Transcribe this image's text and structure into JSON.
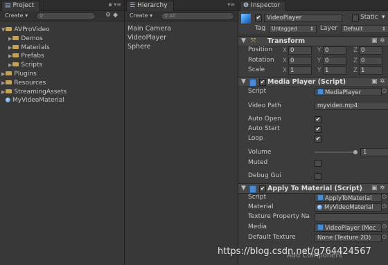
{
  "project": {
    "tab_label": "Project",
    "create_label": "Create",
    "tree": [
      {
        "label": "AVProVideo",
        "depth": 0,
        "expanded": true
      },
      {
        "label": "Demos",
        "depth": 1,
        "expanded": false
      },
      {
        "label": "Materials",
        "depth": 1,
        "expanded": false
      },
      {
        "label": "Prefabs",
        "depth": 1,
        "expanded": false
      },
      {
        "label": "Scripts",
        "depth": 1,
        "expanded": false
      },
      {
        "label": "Plugins",
        "depth": 0,
        "expanded": false
      },
      {
        "label": "Resources",
        "depth": 0,
        "expanded": false
      },
      {
        "label": "StreamingAssets",
        "depth": 0,
        "expanded": false
      },
      {
        "label": "MyVideoMaterial",
        "depth": 0,
        "type": "material"
      }
    ]
  },
  "hierarchy": {
    "tab_label": "Hierarchy",
    "create_label": "Create",
    "search_placeholder": "All",
    "items": [
      "Main Camera",
      "VideoPlayer",
      "Sphere"
    ]
  },
  "inspector": {
    "tab_label": "Inspector",
    "object_name": "VideoPlayer",
    "static_label": "Static",
    "tag_label": "Tag",
    "tag_value": "Untagged",
    "layer_label": "Layer",
    "layer_value": "Default",
    "transform": {
      "title": "Transform",
      "rows": [
        {
          "label": "Position",
          "x": "0",
          "y": "0",
          "z": "0"
        },
        {
          "label": "Rotation",
          "x": "0",
          "y": "0",
          "z": "0"
        },
        {
          "label": "Scale",
          "x": "1",
          "y": "1",
          "z": "1"
        }
      ]
    },
    "media_player": {
      "title": "Media Player (Script)",
      "script_label": "Script",
      "script_value": "MediaPlayer",
      "video_path_label": "Video Path",
      "video_path_value": "myvideo.mp4",
      "auto_open_label": "Auto Open",
      "auto_start_label": "Auto Start",
      "loop_label": "Loop",
      "volume_label": "Volume",
      "volume_value": "1",
      "muted_label": "Muted",
      "debug_gui_label": "Debug Gui"
    },
    "apply_to_material": {
      "title": "Apply To Material (Script)",
      "script_label": "Script",
      "script_value": "ApplyToMaterial",
      "material_label": "Material",
      "material_value": "MyVideoMaterial",
      "texture_property_label": "Texture Property Na",
      "media_label": "Media",
      "media_value": "VideoPlayer (Mec",
      "default_texture_label": "Default Texture",
      "default_texture_value": "None (Texture 2D)"
    },
    "add_component_label": "Add Component"
  },
  "watermark": "https://blog.csdn.net/g764424567",
  "colors": {
    "panel_bg": "#383838",
    "tab_bar_bg": "#2d2d2d",
    "folder": "#c3a25a",
    "script_icon": "#4a8bd1"
  }
}
